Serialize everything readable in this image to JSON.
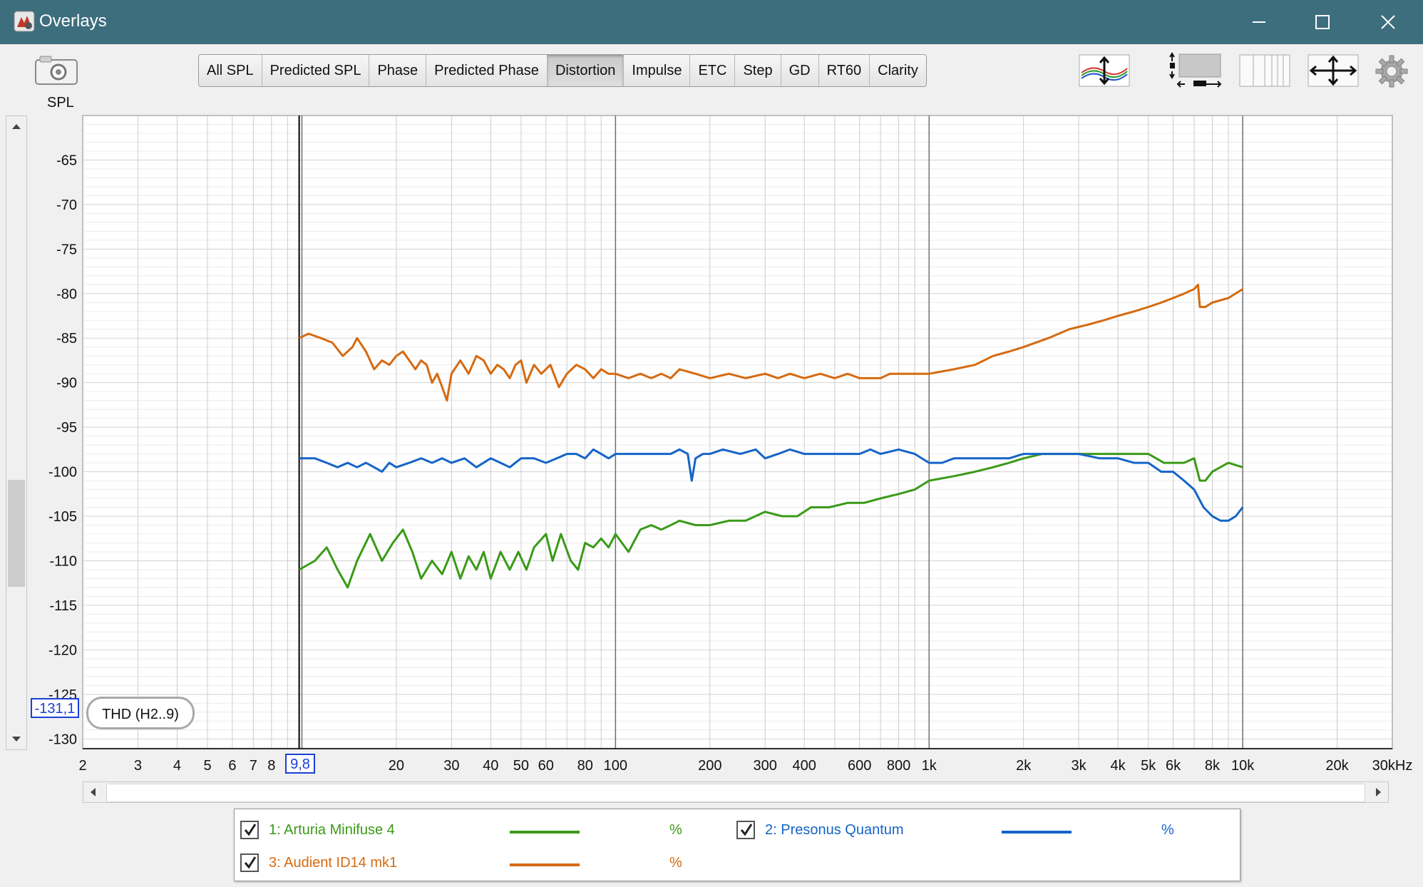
{
  "window": {
    "title": "Overlays"
  },
  "toolbar": {
    "tabs": [
      "All SPL",
      "Predicted SPL",
      "Phase",
      "Predicted Phase",
      "Distortion",
      "Impulse",
      "ETC",
      "Step",
      "GD",
      "RT60",
      "Clarity"
    ],
    "active_tab": "Distortion"
  },
  "icons": {
    "app": "app-icon",
    "camera": "camera-icon",
    "traces": "trace-arrangement-icon",
    "limits": "graph-limits-icon",
    "columns": "columns-icon",
    "move": "move-arrows-icon",
    "settings": "gear-icon"
  },
  "chart_data": {
    "type": "line",
    "ylabel": "SPL",
    "xunit": "Hz",
    "xscale": "log",
    "xlim": [
      2,
      30000
    ],
    "ylim": [
      -131.1,
      -60
    ],
    "grid": true,
    "y_ticks": [
      "-65",
      "-70",
      "-75",
      "-80",
      "-85",
      "-90",
      "-95",
      "-100",
      "-105",
      "-110",
      "-115",
      "-120",
      "-125",
      "-130"
    ],
    "x_ticks": [
      {
        "v": 2,
        "l": "2"
      },
      {
        "v": 3,
        "l": "3"
      },
      {
        "v": 4,
        "l": "4"
      },
      {
        "v": 5,
        "l": "5"
      },
      {
        "v": 6,
        "l": "6"
      },
      {
        "v": 7,
        "l": "7"
      },
      {
        "v": 8,
        "l": "8"
      },
      {
        "v": 20,
        "l": "20"
      },
      {
        "v": 30,
        "l": "30"
      },
      {
        "v": 40,
        "l": "40"
      },
      {
        "v": 50,
        "l": "50"
      },
      {
        "v": 60,
        "l": "60"
      },
      {
        "v": 80,
        "l": "80"
      },
      {
        "v": 100,
        "l": "100"
      },
      {
        "v": 200,
        "l": "200"
      },
      {
        "v": 300,
        "l": "300"
      },
      {
        "v": 400,
        "l": "400"
      },
      {
        "v": 600,
        "l": "600"
      },
      {
        "v": 800,
        "l": "800"
      },
      {
        "v": 1000,
        "l": "1k"
      },
      {
        "v": 2000,
        "l": "2k"
      },
      {
        "v": 3000,
        "l": "3k"
      },
      {
        "v": 4000,
        "l": "4k"
      },
      {
        "v": 5000,
        "l": "5k"
      },
      {
        "v": 6000,
        "l": "6k"
      },
      {
        "v": 8000,
        "l": "8k"
      },
      {
        "v": 10000,
        "l": "10k"
      },
      {
        "v": 20000,
        "l": "20k"
      },
      {
        "v": 30000,
        "l": "30kHz"
      }
    ],
    "cursor": {
      "x": 9.8,
      "x_label": "9,8",
      "y": -131.1,
      "y_label": "-131,1"
    },
    "annotation": "THD (H2..9)",
    "series": [
      {
        "name": "1: Arturia Minifuse 4",
        "color": "#3a9a18",
        "unit": "%",
        "points": [
          [
            9.8,
            -111
          ],
          [
            11,
            -110
          ],
          [
            12,
            -108.5
          ],
          [
            13,
            -111
          ],
          [
            14,
            -113
          ],
          [
            15,
            -110
          ],
          [
            16.5,
            -107
          ],
          [
            18,
            -110
          ],
          [
            19.5,
            -108
          ],
          [
            21,
            -106.5
          ],
          [
            22.5,
            -109
          ],
          [
            24,
            -112
          ],
          [
            26,
            -110
          ],
          [
            28,
            -111.5
          ],
          [
            30,
            -109
          ],
          [
            32,
            -112
          ],
          [
            34,
            -109.5
          ],
          [
            36,
            -111
          ],
          [
            38,
            -109
          ],
          [
            40,
            -112
          ],
          [
            43,
            -109
          ],
          [
            46,
            -111
          ],
          [
            49,
            -109
          ],
          [
            52,
            -111
          ],
          [
            55,
            -108.5
          ],
          [
            60,
            -107
          ],
          [
            63,
            -110
          ],
          [
            67,
            -107
          ],
          [
            72,
            -110
          ],
          [
            76,
            -111
          ],
          [
            80,
            -108
          ],
          [
            85,
            -108.5
          ],
          [
            90,
            -107.5
          ],
          [
            95,
            -108.5
          ],
          [
            100,
            -107
          ],
          [
            110,
            -109
          ],
          [
            120,
            -106.5
          ],
          [
            130,
            -106
          ],
          [
            140,
            -106.5
          ],
          [
            150,
            -106
          ],
          [
            160,
            -105.5
          ],
          [
            180,
            -106
          ],
          [
            200,
            -106
          ],
          [
            230,
            -105.5
          ],
          [
            260,
            -105.5
          ],
          [
            300,
            -104.5
          ],
          [
            340,
            -105
          ],
          [
            380,
            -105
          ],
          [
            420,
            -104
          ],
          [
            480,
            -104
          ],
          [
            550,
            -103.5
          ],
          [
            620,
            -103.5
          ],
          [
            700,
            -103
          ],
          [
            800,
            -102.5
          ],
          [
            900,
            -102
          ],
          [
            1000,
            -101
          ],
          [
            1200,
            -100.5
          ],
          [
            1400,
            -100
          ],
          [
            1600,
            -99.5
          ],
          [
            1800,
            -99
          ],
          [
            2000,
            -98.5
          ],
          [
            2300,
            -98
          ],
          [
            2600,
            -98
          ],
          [
            3000,
            -98
          ],
          [
            3500,
            -98
          ],
          [
            4000,
            -98
          ],
          [
            4500,
            -98
          ],
          [
            5000,
            -98
          ],
          [
            5300,
            -98.5
          ],
          [
            5600,
            -99
          ],
          [
            6000,
            -99
          ],
          [
            6500,
            -99
          ],
          [
            7000,
            -98.5
          ],
          [
            7300,
            -101
          ],
          [
            7600,
            -101
          ],
          [
            8000,
            -100
          ],
          [
            9000,
            -99
          ],
          [
            10000,
            -99.5
          ]
        ]
      },
      {
        "name": "2: Presonus Quantum",
        "color": "#1564c8",
        "unit": "%",
        "points": [
          [
            9.8,
            -98.5
          ],
          [
            11,
            -98.5
          ],
          [
            12,
            -99
          ],
          [
            13,
            -99.5
          ],
          [
            14,
            -99
          ],
          [
            15,
            -99.5
          ],
          [
            16,
            -99
          ],
          [
            17,
            -99.5
          ],
          [
            18,
            -100
          ],
          [
            19,
            -99
          ],
          [
            20,
            -99.5
          ],
          [
            22,
            -99
          ],
          [
            24,
            -98.5
          ],
          [
            26,
            -99
          ],
          [
            28,
            -98.5
          ],
          [
            30,
            -99
          ],
          [
            33,
            -98.5
          ],
          [
            36,
            -99.5
          ],
          [
            40,
            -98.5
          ],
          [
            43,
            -99
          ],
          [
            46,
            -99.5
          ],
          [
            50,
            -98.5
          ],
          [
            55,
            -98.5
          ],
          [
            60,
            -99
          ],
          [
            65,
            -98.5
          ],
          [
            70,
            -98
          ],
          [
            75,
            -98
          ],
          [
            80,
            -98.5
          ],
          [
            85,
            -97.5
          ],
          [
            90,
            -98
          ],
          [
            95,
            -98.5
          ],
          [
            100,
            -98
          ],
          [
            110,
            -98
          ],
          [
            120,
            -98
          ],
          [
            130,
            -98
          ],
          [
            140,
            -98
          ],
          [
            150,
            -98
          ],
          [
            160,
            -97.5
          ],
          [
            170,
            -98
          ],
          [
            175,
            -101
          ],
          [
            180,
            -98.5
          ],
          [
            190,
            -98
          ],
          [
            200,
            -98
          ],
          [
            220,
            -97.5
          ],
          [
            250,
            -98
          ],
          [
            280,
            -97.5
          ],
          [
            300,
            -98.5
          ],
          [
            330,
            -98
          ],
          [
            360,
            -97.5
          ],
          [
            400,
            -98
          ],
          [
            450,
            -98
          ],
          [
            500,
            -98
          ],
          [
            550,
            -98
          ],
          [
            600,
            -98
          ],
          [
            650,
            -97.5
          ],
          [
            700,
            -98
          ],
          [
            800,
            -97.5
          ],
          [
            900,
            -98
          ],
          [
            1000,
            -99
          ],
          [
            1100,
            -99
          ],
          [
            1200,
            -98.5
          ],
          [
            1400,
            -98.5
          ],
          [
            1600,
            -98.5
          ],
          [
            1800,
            -98.5
          ],
          [
            2000,
            -98
          ],
          [
            2500,
            -98
          ],
          [
            3000,
            -98
          ],
          [
            3500,
            -98.5
          ],
          [
            4000,
            -98.5
          ],
          [
            4500,
            -99
          ],
          [
            5000,
            -99
          ],
          [
            5500,
            -100
          ],
          [
            6000,
            -100
          ],
          [
            6500,
            -101
          ],
          [
            7000,
            -102
          ],
          [
            7500,
            -104
          ],
          [
            8000,
            -105
          ],
          [
            8500,
            -105.5
          ],
          [
            9000,
            -105.5
          ],
          [
            9500,
            -105
          ],
          [
            10000,
            -104
          ]
        ]
      },
      {
        "name": "3: Audient ID14 mk1",
        "color": "#d66a10",
        "unit": "%",
        "points": [
          [
            9.8,
            -85
          ],
          [
            10.5,
            -84.5
          ],
          [
            11.5,
            -85
          ],
          [
            12.5,
            -85.5
          ],
          [
            13.5,
            -87
          ],
          [
            14.5,
            -86
          ],
          [
            15,
            -85
          ],
          [
            16,
            -86.5
          ],
          [
            17,
            -88.5
          ],
          [
            18,
            -87.5
          ],
          [
            19,
            -88
          ],
          [
            20,
            -87
          ],
          [
            21,
            -86.5
          ],
          [
            22,
            -87.5
          ],
          [
            23,
            -88.5
          ],
          [
            24,
            -87.5
          ],
          [
            25,
            -88
          ],
          [
            26,
            -90
          ],
          [
            27,
            -89
          ],
          [
            28,
            -90.5
          ],
          [
            29,
            -92
          ],
          [
            30,
            -89
          ],
          [
            32,
            -87.5
          ],
          [
            34,
            -89
          ],
          [
            36,
            -87
          ],
          [
            38,
            -87.5
          ],
          [
            40,
            -89
          ],
          [
            42,
            -88
          ],
          [
            44,
            -88.5
          ],
          [
            46,
            -89.5
          ],
          [
            48,
            -88
          ],
          [
            50,
            -87.5
          ],
          [
            52,
            -90
          ],
          [
            55,
            -88
          ],
          [
            58,
            -89
          ],
          [
            62,
            -88
          ],
          [
            66,
            -90.5
          ],
          [
            70,
            -89
          ],
          [
            75,
            -88
          ],
          [
            80,
            -88.5
          ],
          [
            85,
            -89.5
          ],
          [
            90,
            -88.5
          ],
          [
            95,
            -89
          ],
          [
            100,
            -89
          ],
          [
            110,
            -89.5
          ],
          [
            120,
            -89
          ],
          [
            130,
            -89.5
          ],
          [
            140,
            -89
          ],
          [
            150,
            -89.5
          ],
          [
            160,
            -88.5
          ],
          [
            180,
            -89
          ],
          [
            200,
            -89.5
          ],
          [
            230,
            -89
          ],
          [
            260,
            -89.5
          ],
          [
            300,
            -89
          ],
          [
            330,
            -89.5
          ],
          [
            360,
            -89
          ],
          [
            400,
            -89.5
          ],
          [
            450,
            -89
          ],
          [
            500,
            -89.5
          ],
          [
            550,
            -89
          ],
          [
            600,
            -89.5
          ],
          [
            650,
            -89.5
          ],
          [
            700,
            -89.5
          ],
          [
            750,
            -89
          ],
          [
            800,
            -89
          ],
          [
            900,
            -89
          ],
          [
            1000,
            -89
          ],
          [
            1200,
            -88.5
          ],
          [
            1400,
            -88
          ],
          [
            1600,
            -87
          ],
          [
            1800,
            -86.5
          ],
          [
            2000,
            -86
          ],
          [
            2400,
            -85
          ],
          [
            2800,
            -84
          ],
          [
            3200,
            -83.5
          ],
          [
            3600,
            -83
          ],
          [
            4000,
            -82.5
          ],
          [
            4500,
            -82
          ],
          [
            5000,
            -81.5
          ],
          [
            5500,
            -81
          ],
          [
            6000,
            -80.5
          ],
          [
            6500,
            -80
          ],
          [
            7000,
            -79.5
          ],
          [
            7200,
            -79
          ],
          [
            7300,
            -81.5
          ],
          [
            7600,
            -81.5
          ],
          [
            8000,
            -81
          ],
          [
            9000,
            -80.5
          ],
          [
            10000,
            -79.5
          ]
        ]
      }
    ]
  },
  "legend": {
    "unit": "%"
  }
}
